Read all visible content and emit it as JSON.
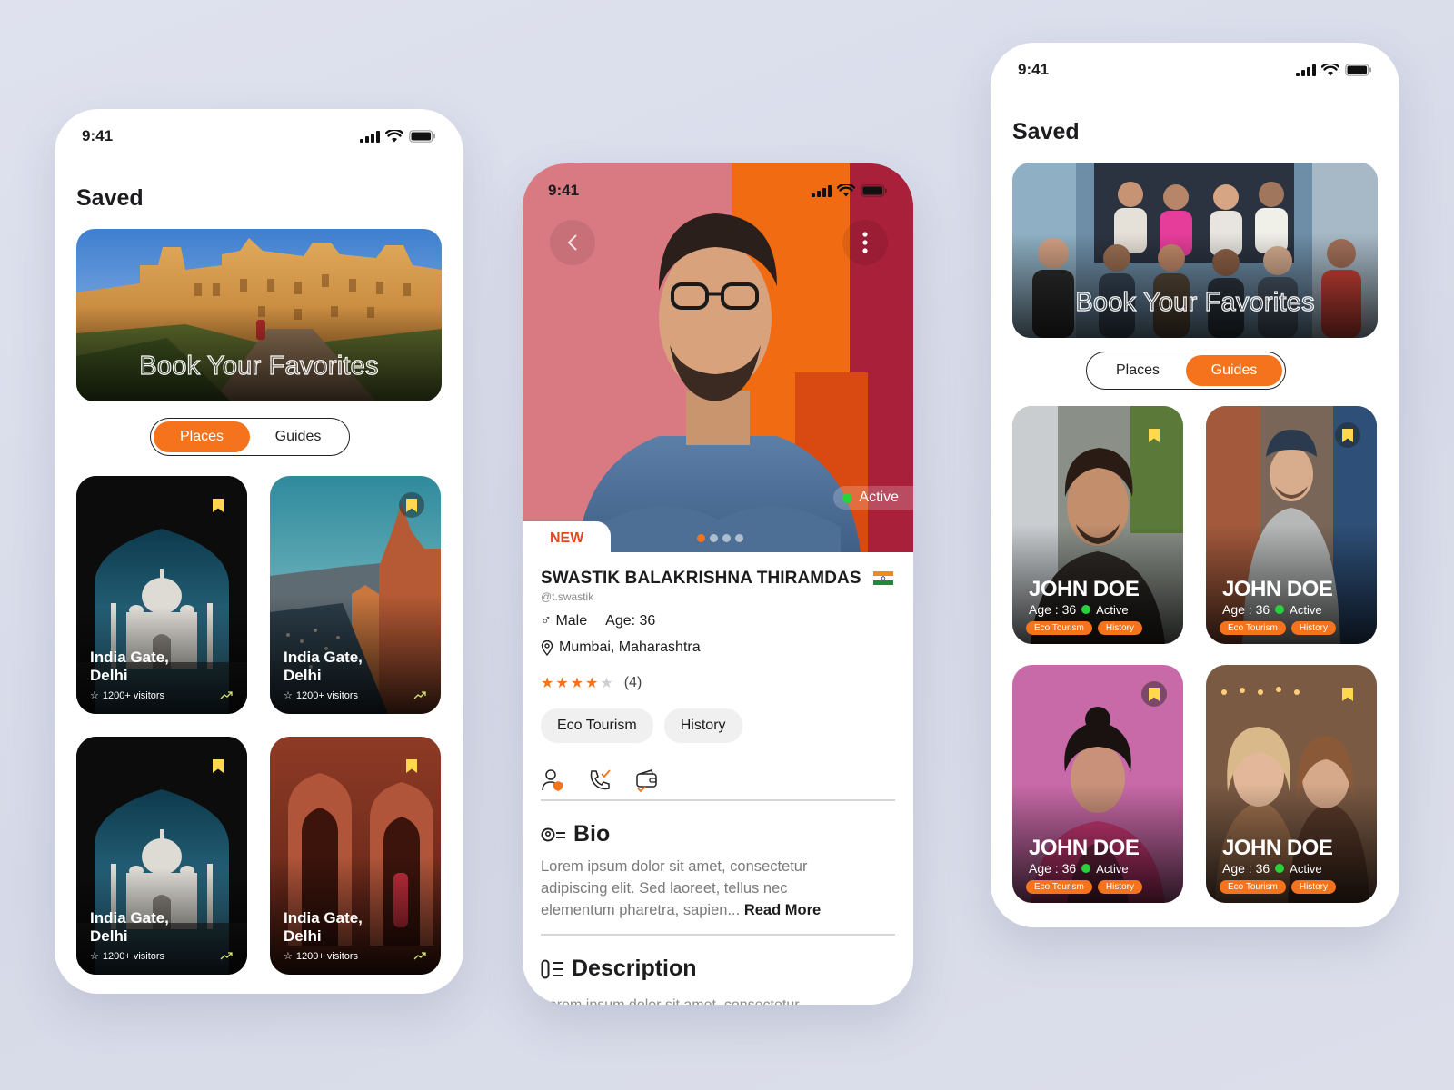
{
  "colors": {
    "accent": "#f5731c",
    "active_dot": "#27d23a",
    "bookmark": "#ffd84d"
  },
  "status_bar": {
    "time": "9:41"
  },
  "left_screen": {
    "title": "Saved",
    "hero_caption": "Book Your Favorites",
    "tabs": [
      "Places",
      "Guides"
    ],
    "active_tab": "Places",
    "places": [
      {
        "name": "India Gate, Delhi",
        "visitors": "1200+ visitors",
        "icon": "trending-up-icon"
      },
      {
        "name": "India Gate, Delhi",
        "visitors": "1200+ visitors",
        "icon": "trending-up-icon"
      },
      {
        "name": "India Gate, Delhi",
        "visitors": "1200+ visitors",
        "icon": "trending-up-icon"
      },
      {
        "name": "India Gate, Delhi",
        "visitors": "1200+ visitors",
        "icon": "trending-up-icon"
      }
    ]
  },
  "profile_screen": {
    "status": "Active",
    "badge": "NEW",
    "name": "SWASTIK BALAKRISHNA THIRAMDAS",
    "handle": "@t.swastik",
    "gender": "Male",
    "age": "Age: 36",
    "location": "Mumbai, Maharashtra",
    "rating": 4,
    "rating_count": "(4)",
    "tags": [
      "Eco Tourism",
      "History"
    ],
    "bio_title": "Bio",
    "bio_text": "Lorem ipsum dolor sit amet, consectetur adipiscing elit. Sed laoreet, tellus nec elementum pharetra, sapien...",
    "read_more": "Read More",
    "description_title": "Description",
    "description_text": "Lorem ipsum dolor sit amet, consectetur"
  },
  "right_screen": {
    "title": "Saved",
    "hero_caption": "Book Your Favorites",
    "tabs": [
      "Places",
      "Guides"
    ],
    "active_tab": "Guides",
    "guides": [
      {
        "name": "JOHN DOE",
        "age": "Age : 36",
        "status": "Active",
        "tags": [
          "Eco Tourism",
          "History"
        ]
      },
      {
        "name": "JOHN DOE",
        "age": "Age : 36",
        "status": "Active",
        "tags": [
          "Eco Tourism",
          "History"
        ]
      },
      {
        "name": "JOHN DOE",
        "age": "Age : 36",
        "status": "Active",
        "tags": [
          "Eco Tourism",
          "History"
        ]
      },
      {
        "name": "JOHN DOE",
        "age": "Age : 36",
        "status": "Active",
        "tags": [
          "Eco Tourism",
          "History"
        ]
      }
    ]
  }
}
